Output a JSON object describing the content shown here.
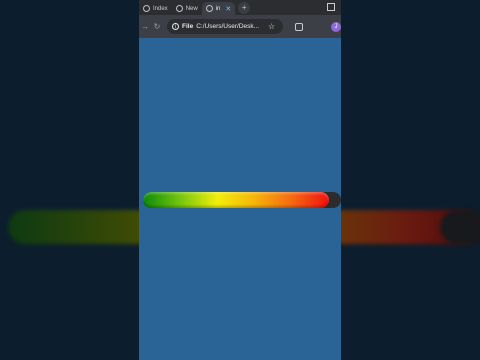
{
  "tabs": [
    {
      "label": "Index",
      "active": false
    },
    {
      "label": "New",
      "active": false
    },
    {
      "label": "in",
      "active": true
    }
  ],
  "new_tab_label": "+",
  "toolbar": {
    "reload_icon": "reload-icon",
    "site_chip": "File",
    "url": "C:/Users/User/Desk...",
    "avatar_letter": "J"
  },
  "progress": {
    "fraction": 0.94,
    "colors": [
      "#0a8a0a",
      "#74c60e",
      "#f2ee0a",
      "#f7b40a",
      "#f46a10",
      "#f01010"
    ]
  }
}
